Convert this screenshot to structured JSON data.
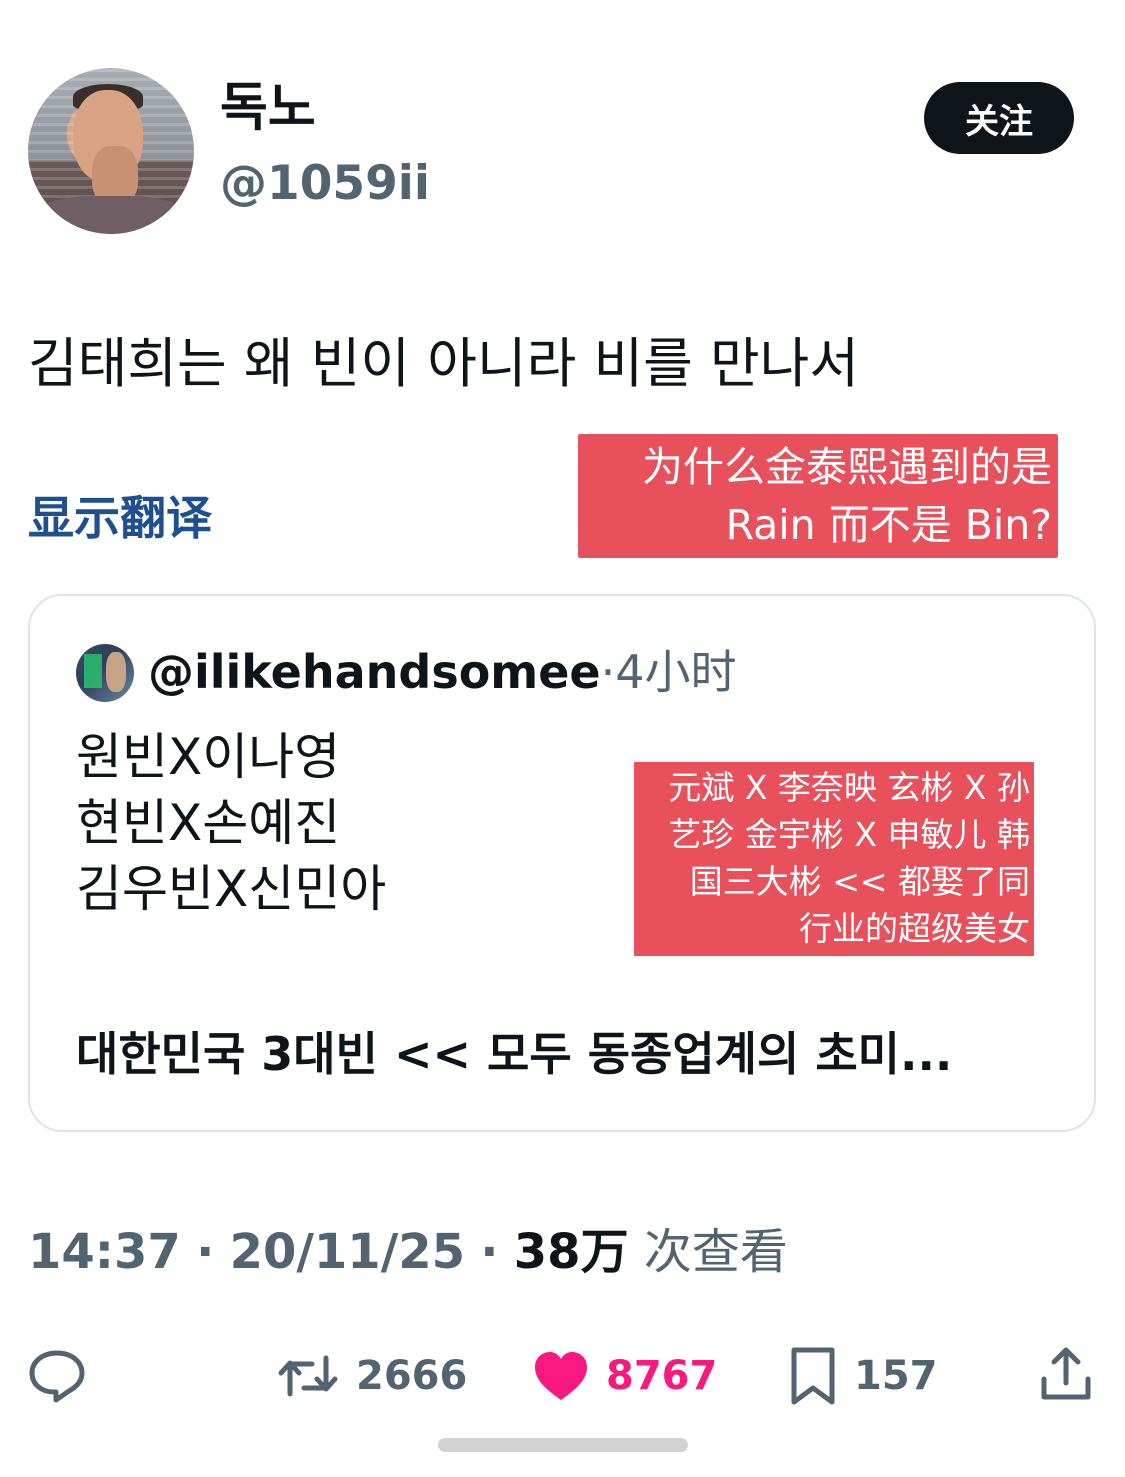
{
  "author": {
    "display_name": "독노",
    "handle": "@1059ii",
    "follow_label": "关注"
  },
  "tweet": {
    "text": "김태희는 왜 빈이 아니라 비를 만나서",
    "translate_label": "显示翻译"
  },
  "translation_overlay": {
    "lines": [
      "为什么金泰熙遇到的是",
      "Rain 而不是 Bin?"
    ]
  },
  "quoted_tweet": {
    "handle": "@ilikehandsomee",
    "separator": "·",
    "time": "4小时",
    "lines": [
      "원빈X이나영",
      "현빈X손예진",
      "김우빈X신민아"
    ],
    "summary": "대한민국 3대빈 << 모두 동종업계의 초미..."
  },
  "quote_overlay": {
    "lines": [
      "元斌 X 李奈映 玄彬 X 孙",
      "艺珍 金宇彬 X 申敏儿 韩",
      "国三大彬 << 都娶了同",
      "行业的超级美女"
    ]
  },
  "meta": {
    "time": "14:37",
    "sep1": "·",
    "date": "20/11/25",
    "sep2": "·",
    "views_count": "38万",
    "views_label": "次查看"
  },
  "actions": {
    "replies": "",
    "retweets": "2666",
    "likes": "8767",
    "bookmarks": "157"
  },
  "colors": {
    "like_active": "#f91880",
    "translate_link": "#1d4f91",
    "overlay_red": "#e8505b",
    "secondary_text": "#536471"
  },
  "icons": [
    "reply-icon",
    "retweet-icon",
    "heart-icon",
    "bookmark-icon",
    "share-icon"
  ]
}
